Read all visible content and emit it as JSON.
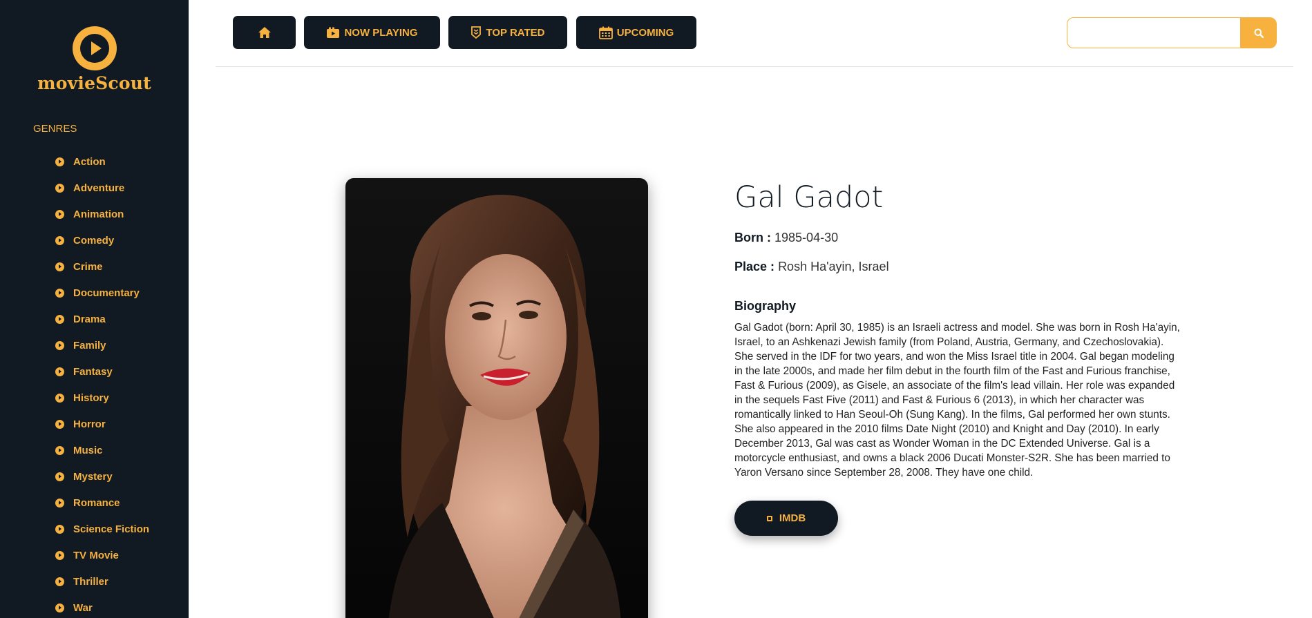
{
  "app": {
    "brand": "movieScout",
    "colors": {
      "accent": "#f6b13f",
      "dark": "#111a23",
      "background": "#ffffff"
    }
  },
  "sidebar": {
    "genres_title": "GENRES",
    "genres": [
      "Action",
      "Adventure",
      "Animation",
      "Comedy",
      "Crime",
      "Documentary",
      "Drama",
      "Family",
      "Fantasy",
      "History",
      "Horror",
      "Music",
      "Mystery",
      "Romance",
      "Science Fiction",
      "TV Movie",
      "Thriller",
      "War"
    ]
  },
  "nav": {
    "home_icon": "home-icon",
    "now_playing": "NOW PLAYING",
    "top_rated": "TOP RATED",
    "upcoming": "UPCOMING"
  },
  "search": {
    "value": "",
    "placeholder": "",
    "icon": "search-icon"
  },
  "person": {
    "name": "Gal Gadot",
    "born_label": "Born :",
    "born": "1985-04-30",
    "place_label": "Place :",
    "place": "Rosh Ha'ayin, Israel",
    "biography_title": "Biography",
    "biography": "Gal Gadot (born: April 30, 1985) is an Israeli actress and model. She was born in Rosh Ha'ayin, Israel, to an Ashkenazi Jewish family (from Poland, Austria, Germany, and Czechoslovakia). She served in the IDF for two years, and won the Miss Israel title in 2004. Gal began modeling in the late 2000s, and made her film debut in the fourth film of the Fast and Furious franchise, Fast & Furious (2009), as Gisele, an associate of the film's lead villain. Her role was expanded in the sequels Fast Five (2011) and Fast & Furious 6 (2013), in which her character was romantically linked to Han Seoul-Oh (Sung Kang). In the films, Gal performed her own stunts. She also appeared in the 2010 films Date Night (2010) and Knight and Day (2010). In early December 2013, Gal was cast as Wonder Woman in the DC Extended Universe. Gal is a motorcycle enthusiast, and owns a black 2006 Ducati Monster-S2R. She has been married to Yaron Versano since September 28, 2008. They have one child.",
    "imdb_label": "IMDB"
  }
}
